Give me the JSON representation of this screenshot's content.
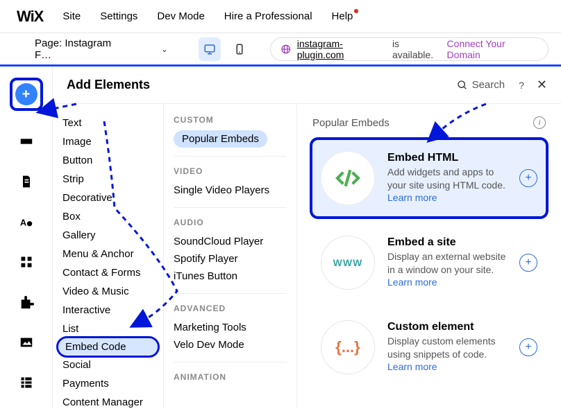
{
  "logo": "WiX",
  "menu": [
    "Site",
    "Settings",
    "Dev Mode",
    "Hire a Professional",
    "Help"
  ],
  "pagebar": {
    "page_label": "Page: Instagram F…",
    "domain": "instagram-plugin.com",
    "avail": "is available.",
    "connect": "Connect Your Domain"
  },
  "panel": {
    "title": "Add Elements",
    "search_placeholder": "Search",
    "help": "?",
    "close": "✕"
  },
  "categories": [
    "Text",
    "Image",
    "Button",
    "Strip",
    "Decorative",
    "Box",
    "Gallery",
    "Menu & Anchor",
    "Contact & Forms",
    "Video & Music",
    "Interactive",
    "List",
    "Embed Code",
    "Social",
    "Payments",
    "Content Manager"
  ],
  "subcol": {
    "custom_head": "CUSTOM",
    "custom": [
      "Popular Embeds"
    ],
    "video_head": "VIDEO",
    "video": [
      "Single Video Players"
    ],
    "audio_head": "AUDIO",
    "audio": [
      "SoundCloud Player",
      "Spotify Player",
      "iTunes Button"
    ],
    "advanced_head": "ADVANCED",
    "advanced": [
      "Marketing Tools",
      "Velo Dev Mode"
    ],
    "animation_head": "ANIMATION"
  },
  "embeds": {
    "heading": "Popular Embeds",
    "cards": [
      {
        "title": "Embed HTML",
        "desc": "Add widgets and apps to your site using HTML code.",
        "learn": "Learn more"
      },
      {
        "title": "Embed a site",
        "desc": "Display an external website in a window on your site.",
        "learn": "Learn more"
      },
      {
        "title": "Custom element",
        "desc": "Display custom elements using snippets of code.",
        "learn": "Learn more"
      }
    ]
  }
}
